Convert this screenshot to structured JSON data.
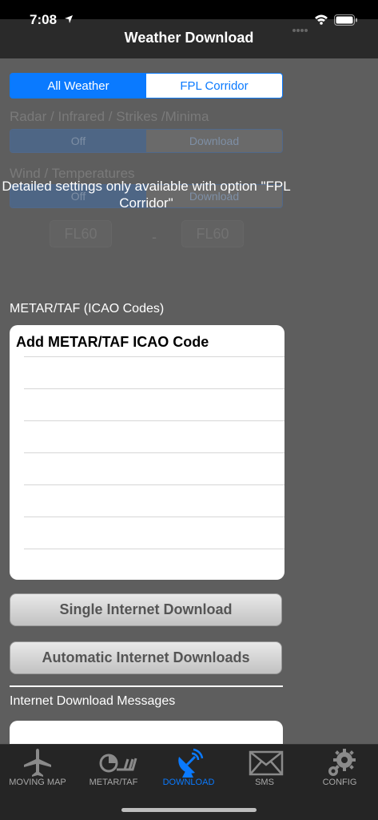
{
  "status": {
    "time": "7:08"
  },
  "nav": {
    "title": "Weather Download"
  },
  "segment": {
    "options": [
      "All Weather",
      "FPL Corridor"
    ],
    "selected": "All Weather"
  },
  "disabled": {
    "radar_label": "Radar / Infrared / Strikes /Minima",
    "radar_options": [
      "Off",
      "Download"
    ],
    "wind_label": "Wind / Temperatures",
    "wind_options": [
      "Off",
      "Download"
    ],
    "fl_from": "FL60",
    "fl_to": "FL60",
    "fl_dash": "-"
  },
  "overlay_message": "Detailed settings only available with option \"FPL Corridor\"",
  "metar": {
    "section_label": "METAR/TAF (ICAO Codes)",
    "add_label": "Add METAR/TAF ICAO Code"
  },
  "buttons": {
    "single": "Single Internet Download",
    "automatic": "Automatic Internet Downloads"
  },
  "messages": {
    "section_label": "Internet Download Messages"
  },
  "tabs": [
    {
      "label": "MOVING MAP",
      "icon": "airplane-icon",
      "active": false
    },
    {
      "label": "METAR/TAF",
      "icon": "weather-station-icon",
      "active": false
    },
    {
      "label": "DOWNLOAD",
      "icon": "satellite-dish-icon",
      "active": true
    },
    {
      "label": "SMS",
      "icon": "envelope-icon",
      "active": false
    },
    {
      "label": "CONFIG",
      "icon": "gears-icon",
      "active": false
    }
  ],
  "colors": {
    "accent": "#0a7aff",
    "background": "#5e5e5e",
    "tabbar": "#252525"
  }
}
